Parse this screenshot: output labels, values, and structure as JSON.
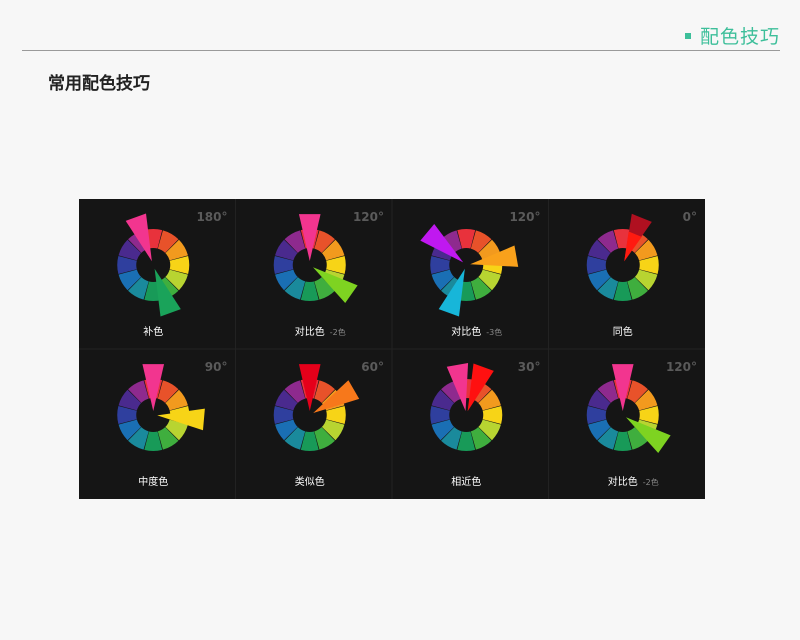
{
  "brand": {
    "label": "配色技巧",
    "accent": "#3dbf9a"
  },
  "page": {
    "title": "常用配色技巧"
  },
  "wheel_colors": [
    "#e8323c",
    "#e8522a",
    "#f29a1e",
    "#f7d417",
    "#b8d431",
    "#3fae3e",
    "#189a58",
    "#1a8a9c",
    "#1a6fb4",
    "#2f3f9e",
    "#4a2a8e",
    "#8e2a8e"
  ],
  "schemes": [
    {
      "label": "补色",
      "sub": "",
      "angle": "180°",
      "pointers": [
        {
          "dir": -20,
          "color": "#f2358f"
        },
        {
          "dir": 160,
          "color": "#1aa35a"
        }
      ]
    },
    {
      "label": "对比色",
      "sub": "-2色",
      "angle": "120°",
      "pointers": [
        {
          "dir": 0,
          "color": "#f2358f"
        },
        {
          "dir": 125,
          "color": "#7ed321"
        }
      ]
    },
    {
      "label": "对比色",
      "sub": "-3色",
      "angle": "120°",
      "pointers": [
        {
          "dir": -50,
          "color": "#c018f0"
        },
        {
          "dir": 80,
          "color": "#f9a11b"
        },
        {
          "dir": 200,
          "color": "#17b6d9"
        }
      ]
    },
    {
      "label": "同色",
      "sub": "",
      "angle": "0°",
      "pointers": [
        {
          "dir": 22,
          "color": "#b01020"
        },
        {
          "dir": 22,
          "color": "#ff1a10",
          "short": true
        }
      ]
    },
    {
      "label": "中度色",
      "sub": "",
      "angle": "90°",
      "pointers": [
        {
          "dir": 0,
          "color": "#f2358f"
        },
        {
          "dir": 95,
          "color": "#f7d417"
        }
      ]
    },
    {
      "label": "类似色",
      "sub": "",
      "angle": "60°",
      "pointers": [
        {
          "dir": 0,
          "color": "#e5001a"
        },
        {
          "dir": 60,
          "color": "#f7781b"
        }
      ]
    },
    {
      "label": "相近色",
      "sub": "",
      "angle": "30°",
      "pointers": [
        {
          "dir": -10,
          "color": "#f2358f"
        },
        {
          "dir": 20,
          "color": "#ff1010"
        }
      ]
    },
    {
      "label": "对比色",
      "sub": "-2色",
      "angle": "120°",
      "pointers": [
        {
          "dir": 0,
          "color": "#f2358f"
        },
        {
          "dir": 125,
          "color": "#7ed321"
        }
      ]
    }
  ]
}
